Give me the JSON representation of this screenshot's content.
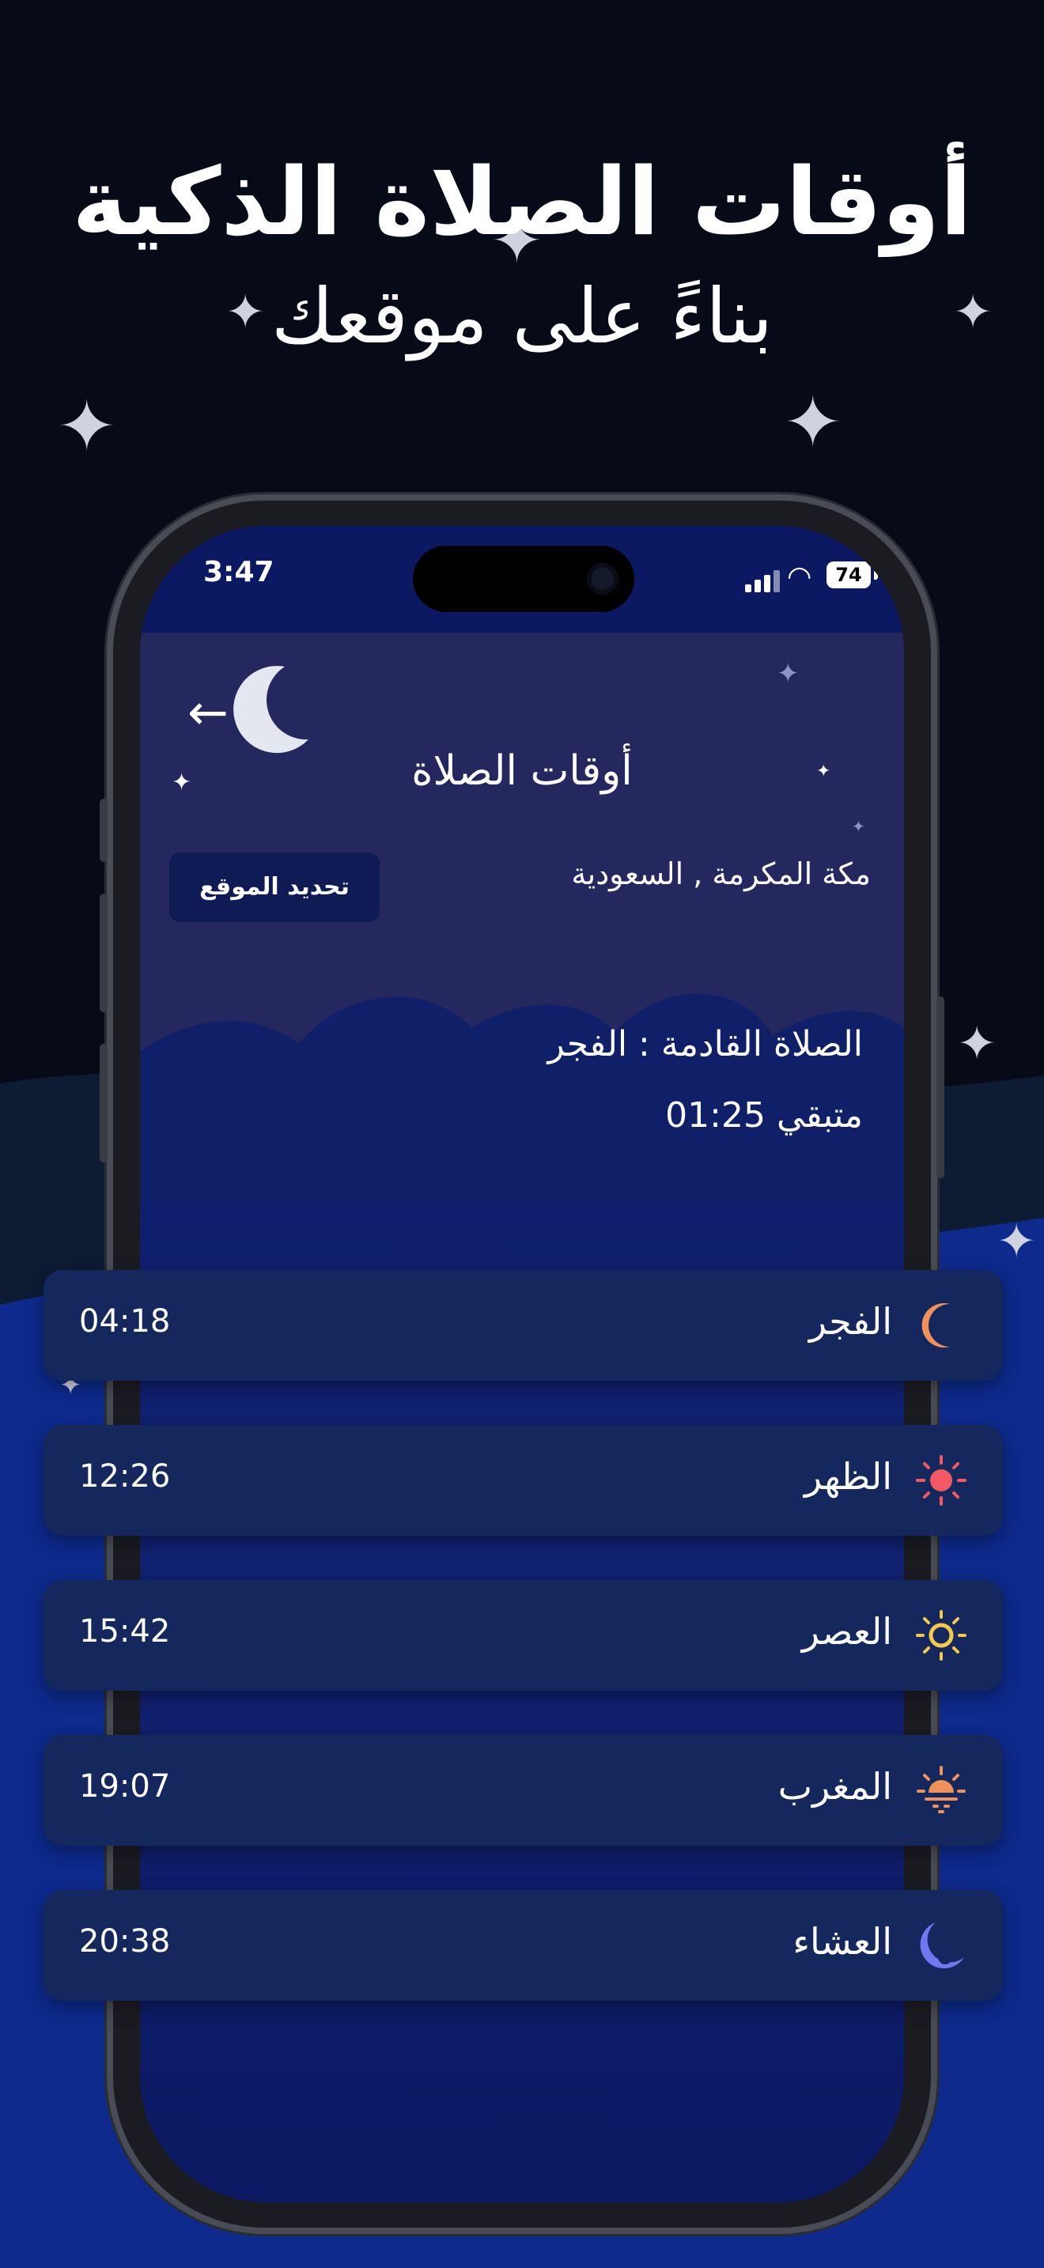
{
  "headline": {
    "title": "أوقات الصلاة الذكية",
    "subtitle": "بناءً على موقعك"
  },
  "status_bar": {
    "time": "3:47",
    "battery": "74"
  },
  "screen": {
    "back_icon": "arrow-left-icon",
    "title": "أوقات الصلاة",
    "location": "مكة المكرمة , السعودية",
    "update_button": "تحديد الموقع",
    "next_prayer": "الصلاة القادمة : الفجر",
    "remaining": "متبقي 01:25"
  },
  "prayers": [
    {
      "name": "الفجر",
      "time": "04:18",
      "icon": "crescent-moon-icon",
      "color": "#f0915a"
    },
    {
      "name": "الظهر",
      "time": "12:26",
      "icon": "sun-icon",
      "color": "#f25a63"
    },
    {
      "name": "العصر",
      "time": "15:42",
      "icon": "sun-outline-icon",
      "color": "#f4c84a"
    },
    {
      "name": "المغرب",
      "time": "19:07",
      "icon": "sunset-icon",
      "color": "#f0915a"
    },
    {
      "name": "العشاء",
      "time": "20:38",
      "icon": "night-moon-icon",
      "color": "#6f78f0"
    }
  ],
  "colors": {
    "background": "#070a17",
    "screen": "#0b1963",
    "card": "#14285e",
    "header": "#24285e"
  }
}
